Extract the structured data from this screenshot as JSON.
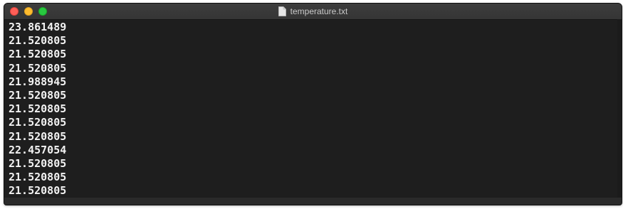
{
  "window": {
    "title": "temperature.txt",
    "icon": "document-icon"
  },
  "file": {
    "lines": [
      "23.861489",
      "21.520805",
      "21.520805",
      "21.520805",
      "21.988945",
      "21.520805",
      "21.520805",
      "21.520805",
      "21.520805",
      "22.457054",
      "21.520805",
      "21.520805",
      "21.520805"
    ]
  },
  "colors": {
    "close": "#fe5f57",
    "minimize": "#febc2e",
    "zoom": "#28c840",
    "background": "#1e1e1e",
    "text": "#f2f2f2"
  }
}
